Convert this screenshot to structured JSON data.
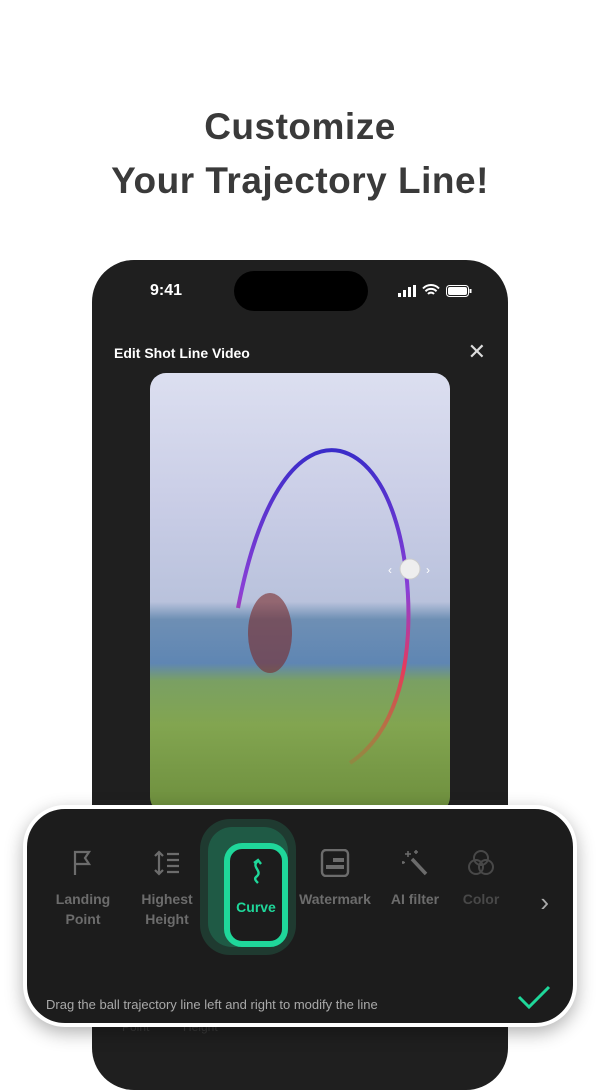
{
  "headline": {
    "line1": "Customize",
    "line2": "Your Trajectory Line!"
  },
  "phone": {
    "time": "9:41",
    "title": "Edit Shot Line Video"
  },
  "ghost_labels": [
    "Point",
    "Height"
  ],
  "toolbar": {
    "items": [
      {
        "label1": "Landing",
        "label2": "Point",
        "icon": "flag-icon"
      },
      {
        "label1": "Highest",
        "label2": "Height",
        "icon": "height-icon"
      },
      {
        "label1": "Curve",
        "icon": "curve-arrow-icon",
        "selected": true
      },
      {
        "label1": "Watermark",
        "icon": "watermark-icon"
      },
      {
        "label1": "AI filter",
        "icon": "magic-wand-icon"
      },
      {
        "label1": "Color",
        "icon": "color-circles-icon"
      }
    ],
    "hint": "Drag the ball trajectory line left and right to modify the line",
    "accent": "#1fd79a"
  }
}
